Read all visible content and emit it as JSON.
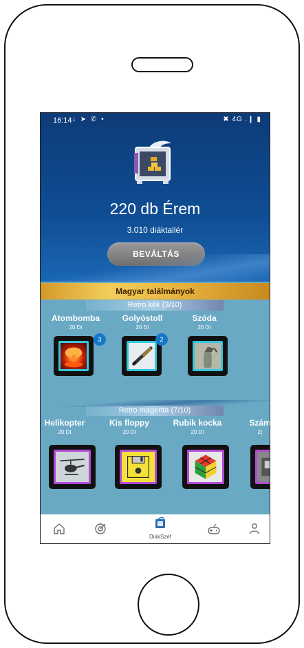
{
  "status_bar": {
    "time": "16:14",
    "left_icons": "↓ ➤ ✆ •",
    "right_icons": "✖ 4G .❙ ▮"
  },
  "hero": {
    "medal_count": "220 db Érem",
    "thaler_balance": "3.010 diáktallér",
    "redeem_label": "BEVÁLTÁS"
  },
  "collection_title": "Magyar találmányok",
  "sections": [
    {
      "label": "Retro kék (3/10)",
      "color": "#35c6dc",
      "items": [
        {
          "name": "Atombomba",
          "price": "20 Dt",
          "badge": "3",
          "icon": "mushroom-cloud-icon"
        },
        {
          "name": "Golyóstoll",
          "price": "20 Dt",
          "badge": "2",
          "icon": "ballpoint-pen-icon"
        },
        {
          "name": "Szóda",
          "price": "20 Dt",
          "badge": "",
          "icon": "soda-siphon-icon"
        }
      ]
    },
    {
      "label": "Retro magenta (7/10)",
      "color": "#b24bd6",
      "items": [
        {
          "name": "Helikopter",
          "price": "20 Dt",
          "icon": "helicopter-icon"
        },
        {
          "name": "Kis floppy",
          "price": "20 Dt",
          "icon": "floppy-disk-icon"
        },
        {
          "name": "Rubik kocka",
          "price": "20 Dt",
          "icon": "rubiks-cube-icon"
        },
        {
          "name": "Szám",
          "price": "2(",
          "icon": "device-icon"
        }
      ]
    }
  ],
  "bottom_nav": {
    "active_label": "DiákSzéf"
  }
}
